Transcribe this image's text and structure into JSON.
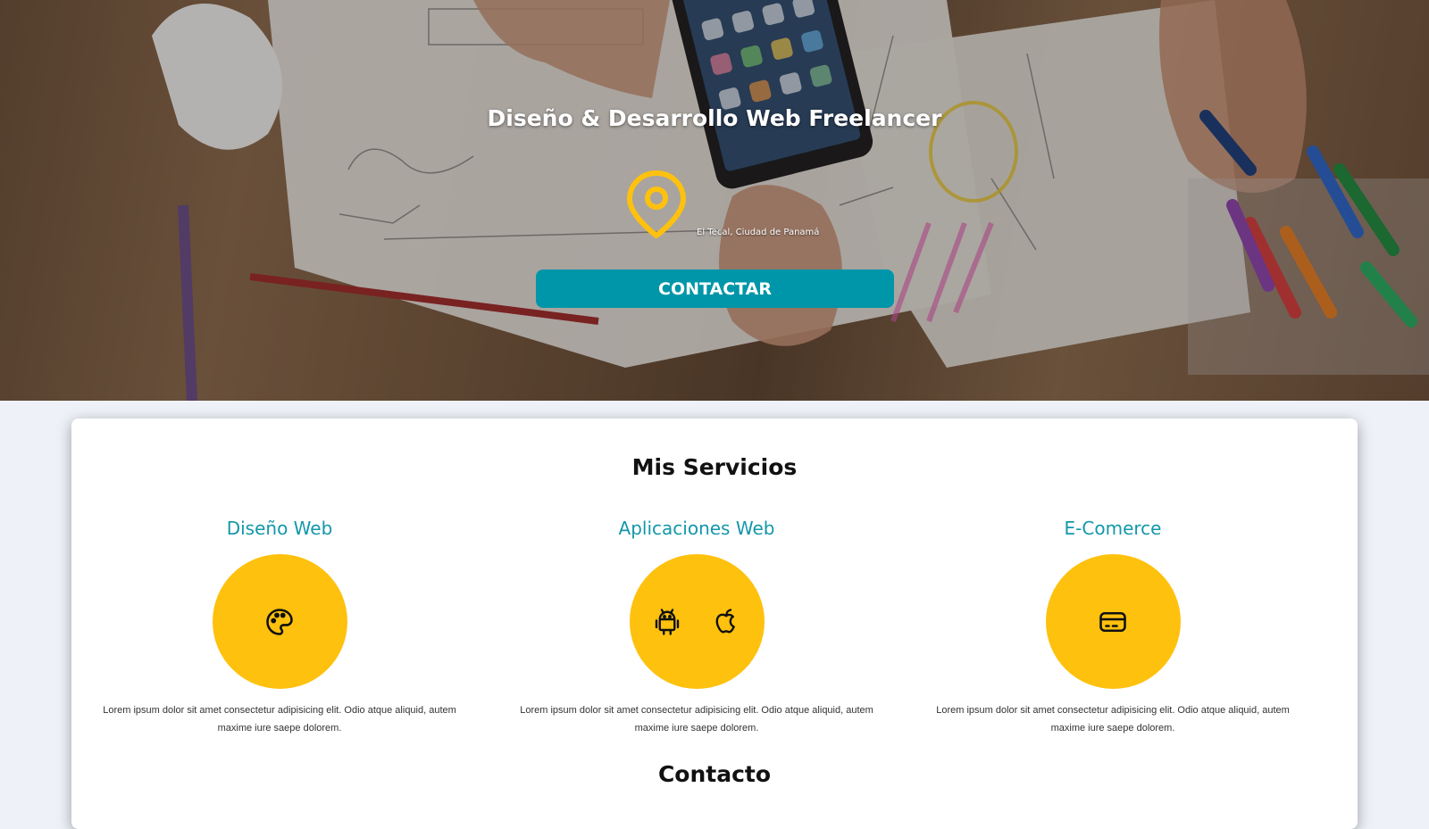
{
  "hero": {
    "title": "Diseño & Desarrollo Web Freelancer",
    "location": "El Tecal, Ciudad de Panamá",
    "contact_button": "CONTACTAR",
    "pin_icon": "location-pin-icon"
  },
  "services": {
    "title": "Mis Servicios",
    "items": [
      {
        "name": "Diseño Web",
        "icons": [
          "palette-icon"
        ],
        "description": "Lorem ipsum dolor sit amet consectetur adipisicing elit. Odio atque aliquid, autem maxime iure saepe dolorem."
      },
      {
        "name": "Aplicaciones Web",
        "icons": [
          "android-icon",
          "apple-icon"
        ],
        "description": "Lorem ipsum dolor sit amet consectetur adipisicing elit. Odio atque aliquid, autem maxime iure saepe dolorem."
      },
      {
        "name": "E-Comerce",
        "icons": [
          "credit-card-icon"
        ],
        "description": "Lorem ipsum dolor sit amet consectetur adipisicing elit. Odio atque aliquid, autem maxime iure saepe dolorem."
      }
    ]
  },
  "contact": {
    "title": "Contacto"
  },
  "colors": {
    "accent_yellow": "#fec10e",
    "teal": "#0096a9",
    "service_title": "#1497aa"
  }
}
